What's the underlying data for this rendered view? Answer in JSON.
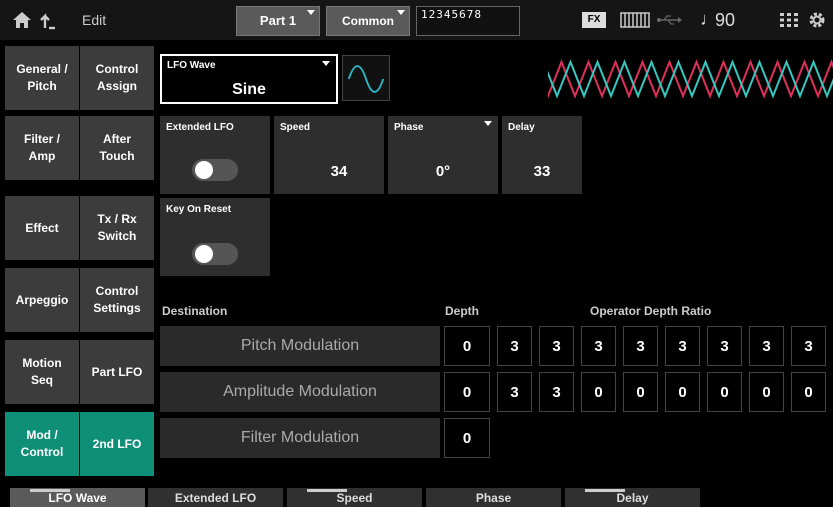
{
  "header": {
    "edit_label": "Edit",
    "part_label": "Part 1",
    "common_label": "Common",
    "part_numbers": "12345678",
    "fx_label": "FX",
    "tempo_note": "♩",
    "tempo_value": "90"
  },
  "sidebar": {
    "left": [
      {
        "label": "General / Pitch"
      },
      {
        "label": "Filter / Amp"
      },
      {
        "label": "Effect"
      },
      {
        "label": "Arpeggio"
      },
      {
        "label": "Motion Seq"
      },
      {
        "label": "Mod / Control"
      }
    ],
    "right": [
      {
        "label": "Control Assign"
      },
      {
        "label": "After Touch"
      },
      {
        "label": "Tx / Rx Switch"
      },
      {
        "label": "Control Settings"
      },
      {
        "label": "Part LFO"
      },
      {
        "label": "2nd LFO"
      }
    ]
  },
  "lfo_wave": {
    "label": "LFO Wave",
    "value": "Sine"
  },
  "extended_lfo": {
    "label": "Extended LFO",
    "on": false
  },
  "speed": {
    "label": "Speed",
    "value": "34"
  },
  "phase": {
    "label": "Phase",
    "value": "0°"
  },
  "delay": {
    "label": "Delay",
    "value": "33"
  },
  "key_on_reset": {
    "label": "Key On Reset",
    "on": false
  },
  "table": {
    "destination_label": "Destination",
    "depth_label": "Depth",
    "ratio_label": "Operator Depth Ratio",
    "rows": [
      {
        "name": "Pitch Modulation",
        "depth": "0",
        "ratios": [
          "3",
          "3",
          "3",
          "3",
          "3",
          "3",
          "3",
          "3"
        ]
      },
      {
        "name": "Amplitude Modulation",
        "depth": "0",
        "ratios": [
          "3",
          "3",
          "0",
          "0",
          "0",
          "0",
          "0",
          "0"
        ]
      },
      {
        "name": "Filter Modulation",
        "depth": "0",
        "ratios": []
      }
    ]
  },
  "bottom_bar": [
    "LFO Wave",
    "Extended LFO",
    "Speed",
    "Phase",
    "Delay"
  ],
  "colors": {
    "accent": "#0f8f78",
    "wave_red": "#e0305a",
    "wave_cyan": "#36c8c0"
  }
}
